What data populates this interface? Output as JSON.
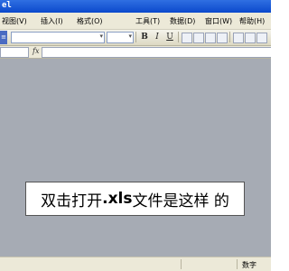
{
  "window": {
    "title": "el"
  },
  "menu": {
    "items": [
      {
        "label": "视图(V)"
      },
      {
        "label": "插入(I)"
      },
      {
        "label": "格式(O)"
      },
      {
        "label": "工具(T)"
      },
      {
        "label": "数据(D)"
      },
      {
        "label": "窗口(W)"
      },
      {
        "label": "帮助(H)"
      }
    ]
  },
  "toolbar": {
    "bold_label": "B",
    "italic_label": "I",
    "underline_label": "U"
  },
  "formula_bar": {
    "fx_label": "fx"
  },
  "caption": {
    "text_before": "双击打开",
    "text_bold": ".xls",
    "text_after": "文件是这样 的"
  },
  "status": {
    "mode": "数字"
  },
  "colors": {
    "workspace": "#a6abb4",
    "titlebar": "#0b49cc",
    "menubar": "#ece9d8"
  }
}
